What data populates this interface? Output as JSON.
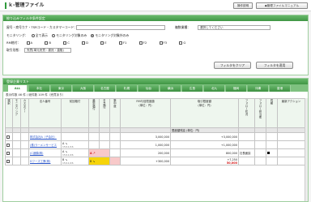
{
  "app": {
    "title": "ｋ-管理ファイル",
    "help_label": "操作説明",
    "manual_label": "◆管理ファイルマニュアル"
  },
  "filter": {
    "header": "絞り込みフィルタ条件設定",
    "keyword_label": "屋号・商号カナ・TSRコード・カスタマーコード：",
    "business_label": "複数業種：",
    "business_select": "選択してください",
    "monitoring_label": "モニタリング：",
    "monitoring_options": [
      "全て表示",
      "モニタリング対象のみ",
      "モニタリング対象外のみ"
    ],
    "rm_label": "RM格付：",
    "rm_options": [
      "A",
      "B",
      "C",
      "D",
      "E",
      "F1",
      "F2",
      "F3",
      "G"
    ],
    "branch_label": "取引形態：",
    "branch_select": "売買(単元売買・委託・直販)",
    "clear_button": "フィルタをクリア",
    "apply_button": "フィルタを適用"
  },
  "list": {
    "header": "登録企業リスト",
    "tabs": [
      "ALL",
      "本社",
      "東京",
      "大阪",
      "名古屋",
      "札幌",
      "仙台",
      "横浜",
      "広島",
      "北九",
      "福岡",
      "沖縄",
      "香港"
    ],
    "count_text": "表示件数 46 件 / 総件数 109 件（売買あり）",
    "columns": {
      "select": "選択",
      "monitor": "モニタリング",
      "customer": "カスタマー",
      "company": "法人番号",
      "rating_prev": "前回格付",
      "rating_now": "最新格付",
      "rm_rank": "RM格付",
      "concentration": "集中度",
      "rm_limit": "RM与信限度額",
      "rm_limit_sub": "(単位：円)",
      "trade_limit": "取引限度額",
      "trade_limit_sub": "(単位：円)",
      "follow": "フォロー状況",
      "memo": "フォロー担当者",
      "sync": "同期",
      "detail": "最新アクション"
    },
    "sub_headers": {
      "limit_amount": "限度額残高",
      "limit_currency": "(単位：円)"
    },
    "rows": [
      {
        "name": "株式会社A（子会社）",
        "code": "",
        "rating_prev": "",
        "rating_now": "",
        "rm_limit": "",
        "trade_limit": "",
        "trade_balance": "",
        "follow": "",
        "has_mark": false
      },
      {
        "name": "(株)ラーメンサービス",
        "code": "",
        "rating_prev": "A ↘",
        "rating_date": "15/11/16",
        "rating_now": "",
        "rm_limit": "",
        "trade_limit": "",
        "trade_balance": "",
        "follow": "",
        "has_mark": false
      },
      {
        "name": "(C酒類(株)",
        "code": "",
        "rating_prev": "A ↘",
        "rating_date": "15/11/26",
        "rating_now": "A ↗",
        "rm_limit": "200,000",
        "trade_limit": "",
        "trade_balance": "",
        "follow": "社長面談",
        "has_mark": true
      },
      {
        "name": "Dフーズ工業(株)",
        "code": "",
        "rating_prev": "B ↘",
        "rating_date": "15/11/26",
        "rating_now": "B ↘",
        "rm_limit": "",
        "trade_limit": "",
        "trade_balance": "50,000",
        "follow": "",
        "has_mark": false
      }
    ],
    "row_amounts": [
      "3,000,000",
      "+3,000,000",
      "1,000,000",
      "+1,000,000",
      "200,000",
      "800,000",
      "+300,000",
      "+7,250"
    ]
  },
  "colors": {
    "accent": "#3f9644",
    "tab_bg": "#7ec17f",
    "pink_cell": "#f8c9c9",
    "yellow_cell": "#f6d40a",
    "alert_red": "#d41616"
  }
}
